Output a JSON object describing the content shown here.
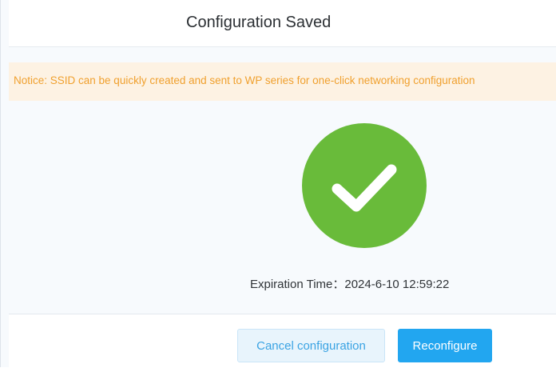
{
  "dialog": {
    "title": "Configuration Saved",
    "notice": "Notice: SSID can be quickly created and sent to WP series for one-click networking configuration",
    "status_icon": "check-circle-icon",
    "expiration_label": "Expiration Time：",
    "expiration_value": "2024-6-10 12:59:22"
  },
  "buttons": {
    "cancel_label": "Cancel configuration",
    "reconfigure_label": "Reconfigure"
  },
  "colors": {
    "success": "#69bb3a",
    "notice_text": "#f0a02e",
    "notice_bg": "#fdf2e3",
    "primary": "#22a6f0"
  }
}
